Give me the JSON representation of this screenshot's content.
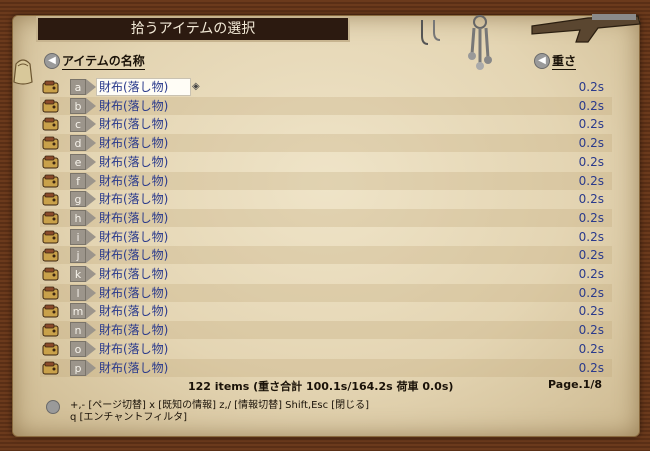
{
  "window": {
    "title": "拾うアイテムの選択"
  },
  "columns": {
    "name_label": "アイテムの名称",
    "weight_label": "重さ"
  },
  "items": [
    {
      "key": "a",
      "name": "財布(落し物)",
      "weight": "0.2s",
      "selected": true
    },
    {
      "key": "b",
      "name": "財布(落し物)",
      "weight": "0.2s"
    },
    {
      "key": "c",
      "name": "財布(落し物)",
      "weight": "0.2s"
    },
    {
      "key": "d",
      "name": "財布(落し物)",
      "weight": "0.2s"
    },
    {
      "key": "e",
      "name": "財布(落し物)",
      "weight": "0.2s"
    },
    {
      "key": "f",
      "name": "財布(落し物)",
      "weight": "0.2s"
    },
    {
      "key": "g",
      "name": "財布(落し物)",
      "weight": "0.2s"
    },
    {
      "key": "h",
      "name": "財布(落し物)",
      "weight": "0.2s"
    },
    {
      "key": "i",
      "name": "財布(落し物)",
      "weight": "0.2s"
    },
    {
      "key": "j",
      "name": "財布(落し物)",
      "weight": "0.2s"
    },
    {
      "key": "k",
      "name": "財布(落し物)",
      "weight": "0.2s"
    },
    {
      "key": "l",
      "name": "財布(落し物)",
      "weight": "0.2s"
    },
    {
      "key": "m",
      "name": "財布(落し物)",
      "weight": "0.2s"
    },
    {
      "key": "n",
      "name": "財布(落し物)",
      "weight": "0.2s"
    },
    {
      "key": "o",
      "name": "財布(落し物)",
      "weight": "0.2s"
    },
    {
      "key": "p",
      "name": "財布(落し物)",
      "weight": "0.2s"
    }
  ],
  "footer": {
    "stats": "122 items  (重さ合計 100.1s/164.2s  荷車 0.0s)",
    "page": "Page.1/8"
  },
  "help": {
    "line1": "+,- [ページ切替]  x [既知の情報]  z,/ [情報切替]  Shift,Esc [閉じる]",
    "line2": "q [エンチャントフィルタ]"
  },
  "icons": {
    "item": "wallet-icon",
    "select": "diamond-cursor-icon",
    "decor_left": "pouch-icon",
    "decor_hooks": "hooks-icon",
    "decor_keys": "keys-icon",
    "decor_right": "pistol-icon"
  },
  "colors": {
    "item_text": "#2a3a8c",
    "title_bg": "#2c1a10",
    "parchment": "#e4d5b3"
  }
}
